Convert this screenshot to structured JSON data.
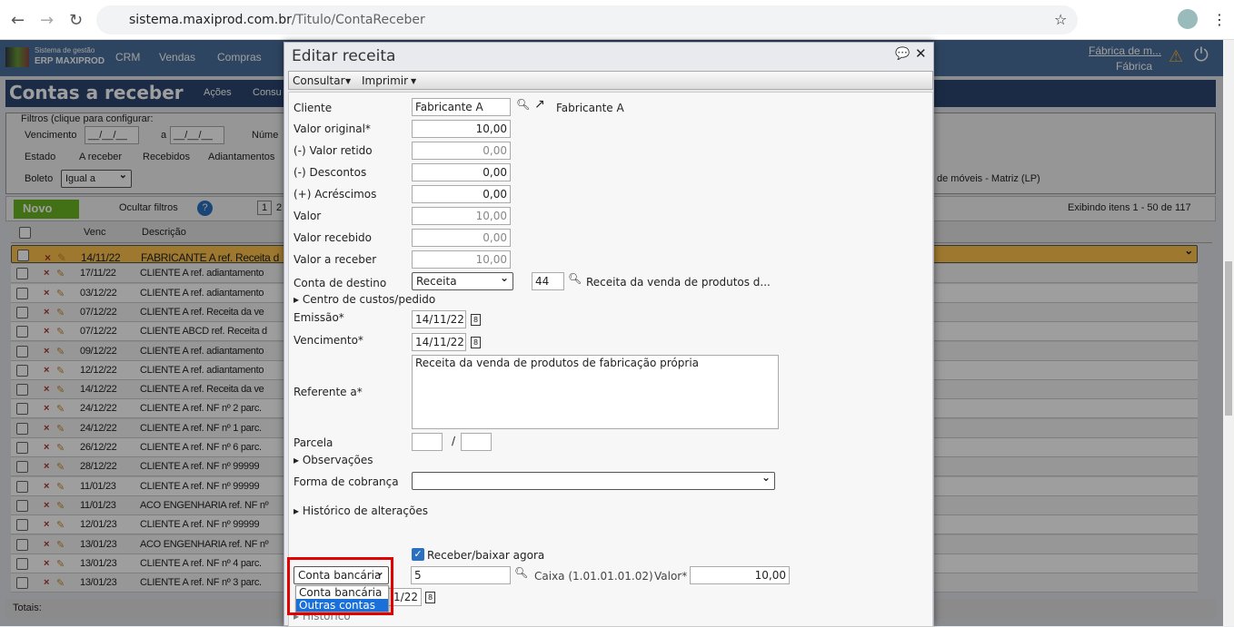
{
  "browser": {
    "url_host": "sistema.maxiprod.com.br",
    "url_path": "/Titulo/ContaReceber"
  },
  "app": {
    "logo_line1": "Sistema de gestão",
    "logo_line2": "ERP MAXIPROD",
    "menus": [
      "CRM",
      "Vendas",
      "Compras"
    ],
    "company": "Fábrica de m...",
    "unit": "Fábrica"
  },
  "page": {
    "title": "Contas a receber",
    "actions": "Ações",
    "consultar": "Consu",
    "filters": {
      "legend": "Filtros (clique para configurar:",
      "vencimento": "Vencimento",
      "date_ph": "__/__/__",
      "a": "a",
      "numero": "Núme",
      "estado": "Estado",
      "a_receber": "A receber",
      "recebidos": "Recebidos",
      "adiantamentos": "Adiantamentos",
      "boleto": "Boleto",
      "boleto_op": "Igual a",
      "empresa": "de móveis - Matriz (LP)"
    },
    "toolbar": {
      "novo": "Novo",
      "ocultar": "Ocultar filtros",
      "page": "1",
      "page2": "2",
      "exibindo": "Exibindo itens 1 - 50 de 117"
    },
    "columns": {
      "venc": "Venc",
      "descricao": "Descrição"
    },
    "rows": [
      {
        "venc": "14/11/22",
        "desc": "FABRICANTE A ref. Receita d"
      },
      {
        "venc": "17/11/22",
        "desc": "CLIENTE A ref. adiantamento"
      },
      {
        "venc": "03/12/22",
        "desc": "CLIENTE A ref. adiantamento"
      },
      {
        "venc": "07/12/22",
        "desc": "CLIENTE A ref. Receita da ve"
      },
      {
        "venc": "07/12/22",
        "desc": "CLIENTE ABCD ref. Receita d"
      },
      {
        "venc": "09/12/22",
        "desc": "CLIENTE A ref. adiantamento"
      },
      {
        "venc": "12/12/22",
        "desc": "CLIENTE A ref. adiantamento"
      },
      {
        "venc": "14/12/22",
        "desc": "CLIENTE A ref. Receita da ve"
      },
      {
        "venc": "24/12/22",
        "desc": "CLIENTE A ref. NF nº 2 parc."
      },
      {
        "venc": "24/12/22",
        "desc": "CLIENTE A ref. NF nº 1 parc."
      },
      {
        "venc": "26/12/22",
        "desc": "CLIENTE A ref. NF nº 6 parc."
      },
      {
        "venc": "28/12/22",
        "desc": "CLIENTE A ref. NF nº 99999"
      },
      {
        "venc": "11/01/23",
        "desc": "CLIENTE A ref. NF nº 99999"
      },
      {
        "venc": "11/01/23",
        "desc": "ACO ENGENHARIA ref. NF nº"
      },
      {
        "venc": "12/01/23",
        "desc": "CLIENTE A ref. NF nº 99999"
      },
      {
        "venc": "13/01/23",
        "desc": "ACO ENGENHARIA ref. NF nº"
      },
      {
        "venc": "13/01/23",
        "desc": "CLIENTE A ref. NF nº 4 parc."
      },
      {
        "venc": "13/01/23",
        "desc": "CLIENTE A ref. NF nº 3 parc."
      }
    ],
    "totais": "Totais:"
  },
  "dialog": {
    "title": "Editar receita",
    "consultar": "Consultar",
    "imprimir": "Imprimir",
    "cliente_label": "Cliente",
    "cliente": "Fabricante A",
    "cliente_link": "Fabricante A",
    "valor_original_label": "Valor original*",
    "valor_original": "10,00",
    "valor_retido_label": "(-) Valor retido",
    "valor_retido": "0,00",
    "descontos_label": "(-) Descontos",
    "descontos": "0,00",
    "acrescimos_label": "(+) Acréscimos",
    "acrescimos": "0,00",
    "valor_label": "Valor",
    "valor": "10,00",
    "valor_recebido_label": "Valor recebido",
    "valor_recebido": "0,00",
    "valor_a_receber_label": "Valor a receber",
    "valor_a_receber": "10,00",
    "conta_destino_label": "Conta de destino",
    "conta_destino": "Receita",
    "conta_codigo": "44",
    "conta_desc": "Receita da venda de produtos d...",
    "centro_custos": "Centro de custos/pedido",
    "emissao_label": "Emissão*",
    "emissao": "14/11/22",
    "vencimento_label": "Vencimento*",
    "vencimento": "14/11/22",
    "referente_label": "Referente a*",
    "referente": "Receita da venda de produtos de fabricação própria",
    "parcela_label": "Parcela",
    "parcela_sep": "/",
    "observacoes": "Observações",
    "forma_cobranca_label": "Forma de cobrança",
    "historico_alteracoes": "Histórico de alterações",
    "receber_agora": "Receber/baixar agora",
    "tipo_conta": "Conta bancária",
    "tipo_options": [
      "Conta bancária",
      "Outras contas"
    ],
    "conta_numero": "5",
    "conta_nome": "Caixa (1.01.01.01.02)",
    "valor_baixa_label": "Valor*",
    "valor_baixa": "10,00",
    "data_baixa_partial": "1/22",
    "historico": "Histórico"
  }
}
